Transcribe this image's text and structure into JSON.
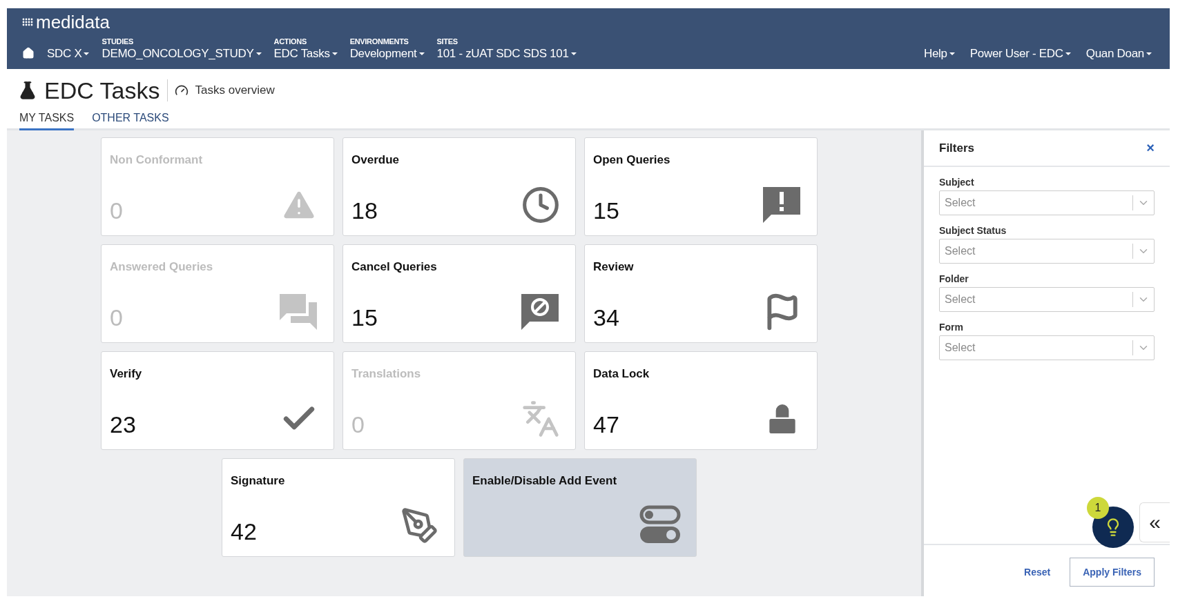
{
  "brand": {
    "name": "medidata"
  },
  "nav": [
    {
      "label": "SDC X"
    },
    {
      "caption": "STUDIES",
      "label": "DEMO_ONCOLOGY_STUDY"
    },
    {
      "caption": "ACTIONS",
      "label": "EDC Tasks"
    },
    {
      "caption": "ENVIRONMENTS",
      "label": "Development"
    },
    {
      "caption": "SITES",
      "label": "101 - zUAT SDC SDS 101"
    }
  ],
  "user_menu": [
    "Help",
    "Power User - EDC",
    "Quan Doan"
  ],
  "page": {
    "title": "EDC Tasks",
    "subtitle": "Tasks overview"
  },
  "tabs": [
    {
      "label": "MY TASKS",
      "selected": true
    },
    {
      "label": "OTHER TASKS",
      "selected": false
    }
  ],
  "tiles": [
    {
      "title": "Non Conformant",
      "count": "0",
      "kind": "warning",
      "disabled": true,
      "highlighted": false
    },
    {
      "title": "Overdue",
      "count": "18",
      "kind": "clock",
      "disabled": false,
      "highlighted": false
    },
    {
      "title": "Open Queries",
      "count": "15",
      "kind": "alert",
      "disabled": false,
      "highlighted": false
    },
    {
      "title": "Answered Queries",
      "count": "0",
      "kind": "answered",
      "disabled": true,
      "highlighted": false
    },
    {
      "title": "Cancel Queries",
      "count": "15",
      "kind": "cancel",
      "disabled": false,
      "highlighted": false
    },
    {
      "title": "Review",
      "count": "34",
      "kind": "review",
      "disabled": false,
      "highlighted": false
    },
    {
      "title": "Verify",
      "count": "23",
      "kind": "verify",
      "disabled": false,
      "highlighted": false
    },
    {
      "title": "Translations",
      "count": "0",
      "kind": "translation",
      "disabled": true,
      "highlighted": false
    },
    {
      "title": "Data Lock",
      "count": "47",
      "kind": "lock",
      "disabled": false,
      "highlighted": false
    },
    {
      "title": "Signature",
      "count": "42",
      "kind": "signature",
      "disabled": false,
      "highlighted": false
    },
    {
      "title": "Enable/Disable Add Event",
      "kind": "toggle",
      "disabled": false,
      "highlighted": true
    }
  ],
  "filters": {
    "title": "Filters",
    "close": "×",
    "fields": [
      {
        "label": "Subject",
        "placeholder": "Select"
      },
      {
        "label": "Subject Status",
        "placeholder": "Select"
      },
      {
        "label": "Folder",
        "placeholder": "Select"
      },
      {
        "label": "Form",
        "placeholder": "Select"
      }
    ],
    "reset": "Reset",
    "apply": "Apply Filters"
  },
  "hint_badge": "1",
  "collapse": "«"
}
